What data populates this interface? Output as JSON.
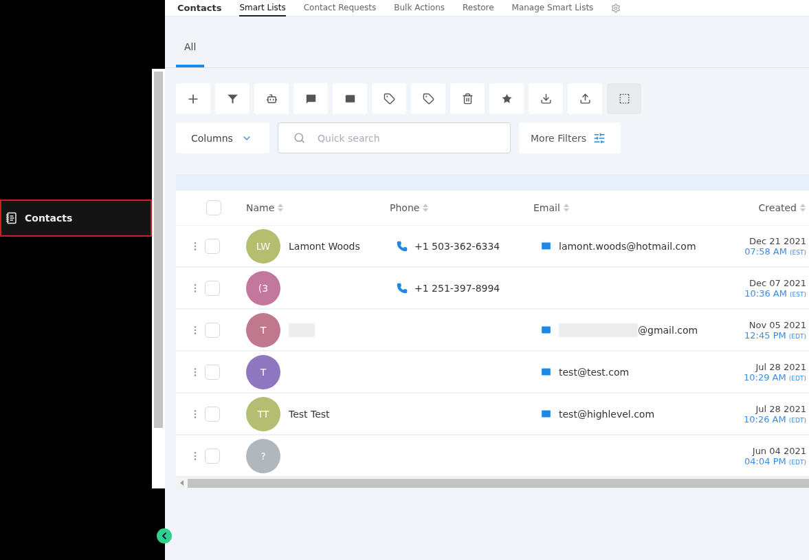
{
  "header": {
    "title": "Contacts",
    "tabs": [
      {
        "label": "Smart Lists",
        "selected": true
      },
      {
        "label": "Contact Requests",
        "selected": false
      },
      {
        "label": "Bulk Actions",
        "selected": false
      },
      {
        "label": "Restore",
        "selected": false
      },
      {
        "label": "Manage Smart Lists",
        "selected": false
      }
    ]
  },
  "sidebar": {
    "items": [
      {
        "label": "Contacts",
        "selected": true
      }
    ]
  },
  "list_tabs": [
    {
      "label": "All",
      "selected": true
    }
  ],
  "toolbar": [
    {
      "selected": false
    },
    {
      "selected": false
    },
    {
      "selected": false
    },
    {
      "selected": false
    },
    {
      "selected": false
    },
    {
      "selected": false
    },
    {
      "selected": false
    },
    {
      "selected": false
    },
    {
      "selected": false
    },
    {
      "selected": false
    },
    {
      "selected": false
    },
    {
      "selected": true
    }
  ],
  "columns_button": "Columns",
  "search": {
    "placeholder": "Quick search"
  },
  "more_filters": "More Filters",
  "table": {
    "select_all_checked": false,
    "columns": [
      "Name",
      "Phone",
      "Email",
      "Created"
    ],
    "rows": [
      {
        "initials": "LW",
        "color": "#b5bd6f",
        "name": "Lamont Woods",
        "phone": "+1 503-362-6334",
        "email": "lamont.woods@hotmail.com",
        "date": "Dec 21 2021",
        "time": "07:58 AM",
        "tz": "(EST)",
        "checked": false
      },
      {
        "initials": "(3",
        "color": "#c4779e",
        "phone": "+1 251-397-8994",
        "date": "Dec 07 2021",
        "time": "10:36 AM",
        "tz": "(EST)",
        "checked": false
      },
      {
        "initials": "T",
        "color": "#c0788f",
        "email": "@gmail.com",
        "redacted_name": true,
        "redacted_email": true,
        "date": "Nov 05 2021",
        "time": "12:45 PM",
        "tz": "(EDT)",
        "checked": false
      },
      {
        "initials": "T",
        "color": "#8e76c0",
        "email": "test@test.com",
        "date": "Jul 28 2021",
        "time": "10:29 AM",
        "tz": "(EDT)",
        "checked": false
      },
      {
        "initials": "TT",
        "color": "#b5bd72",
        "name": "Test Test",
        "email": "test@highlevel.com",
        "date": "Jul 28 2021",
        "time": "10:26 AM",
        "tz": "(EDT)",
        "checked": false
      },
      {
        "initials": "?",
        "color": "#b0b7be",
        "date": "Jun 04 2021",
        "time": "04:04 PM",
        "tz": "(EDT)",
        "checked": false
      }
    ]
  }
}
